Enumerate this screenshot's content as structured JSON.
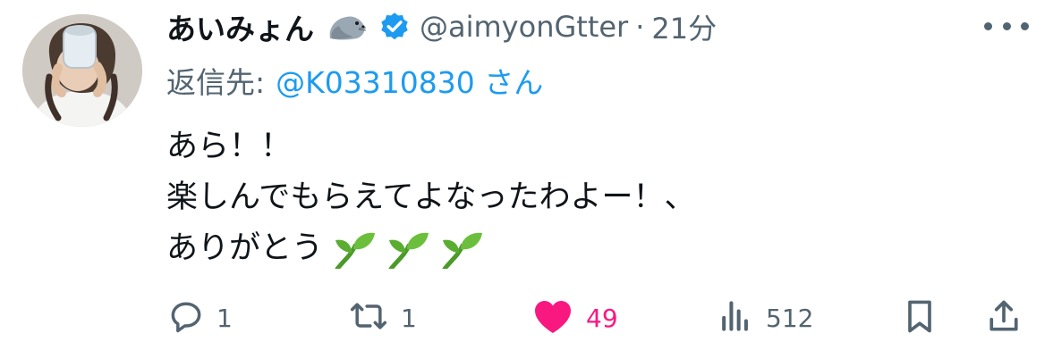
{
  "tweet": {
    "display_name": "あいみょん",
    "handle": "@aimyonGtter",
    "separator": "·",
    "time": "21分",
    "reply_prefix": "返信先:",
    "reply_to": "@K03310830 さん",
    "lines": [
      "あら！！",
      "楽しんでもらえてよなったわよー！、",
      "ありがとう"
    ],
    "name_emoji": "seal",
    "trailing_emoji": [
      "sprout",
      "sprout",
      "sprout"
    ]
  },
  "actions": {
    "replies": "1",
    "retweets": "1",
    "likes": "49",
    "views": "512"
  },
  "colors": {
    "text": "#0f1419",
    "secondary": "#536471",
    "link": "#1d9bf0",
    "like": "#f91880",
    "verified": "#1d9bf0"
  }
}
